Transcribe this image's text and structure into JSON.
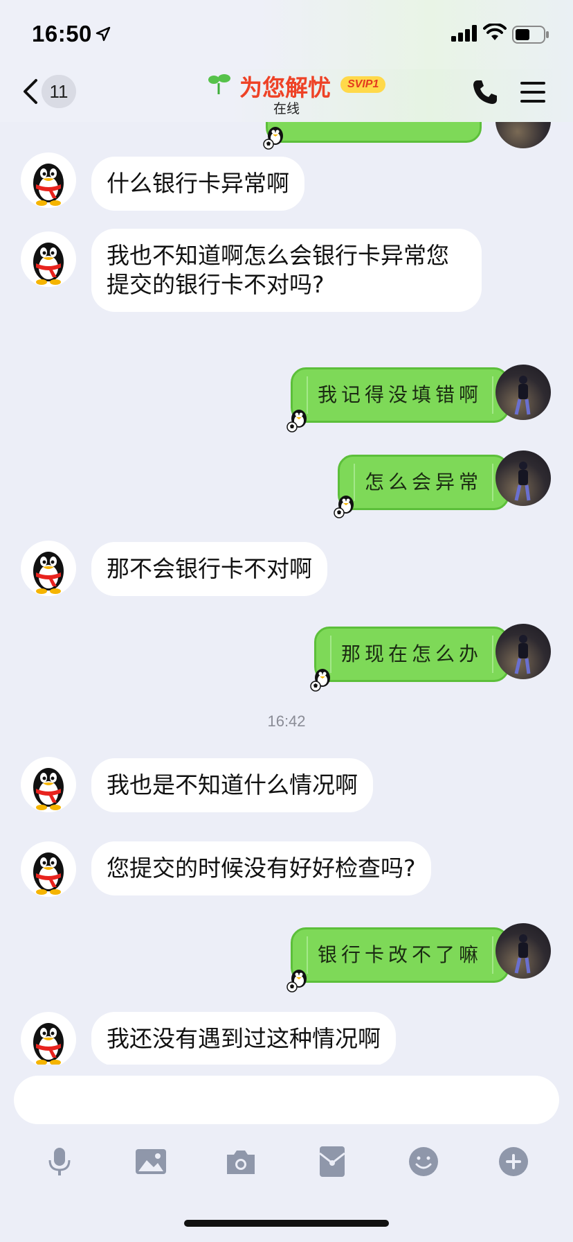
{
  "status_bar": {
    "time": "16:50"
  },
  "header": {
    "back_count": "11",
    "title": "为您解忧",
    "vip_badge": "SVIP1",
    "subtitle": "在线"
  },
  "messages": [
    {
      "side": "in",
      "text": "什么银行卡异常啊"
    },
    {
      "side": "in",
      "text": "我也不知道啊怎么会银行卡异常您\n提交的银行卡不对吗?"
    },
    {
      "side": "out",
      "text": "我记得没填错啊"
    },
    {
      "side": "out",
      "text": "怎么会异常"
    },
    {
      "side": "in",
      "text": "那不会银行卡不对啊"
    },
    {
      "side": "out",
      "text": "那现在怎么办"
    },
    {
      "type": "time",
      "text": "16:42"
    },
    {
      "side": "in",
      "text": "我也是不知道什么情况啊"
    },
    {
      "side": "in",
      "text": "您提交的时候没有好好检查吗?"
    },
    {
      "side": "out",
      "text": "银行卡改不了嘛"
    },
    {
      "side": "in",
      "text": "我还没有遇到过这种情况啊"
    }
  ],
  "input": {
    "placeholder": ""
  },
  "toolbar": [
    "microphone-icon",
    "image-icon",
    "camera-icon",
    "red-packet-icon",
    "emoji-icon",
    "plus-icon"
  ],
  "colors": {
    "accent": "#ee4226",
    "bubble_out": "#7ed958",
    "bubble_in": "#ffffff",
    "background": "#eceef7"
  }
}
